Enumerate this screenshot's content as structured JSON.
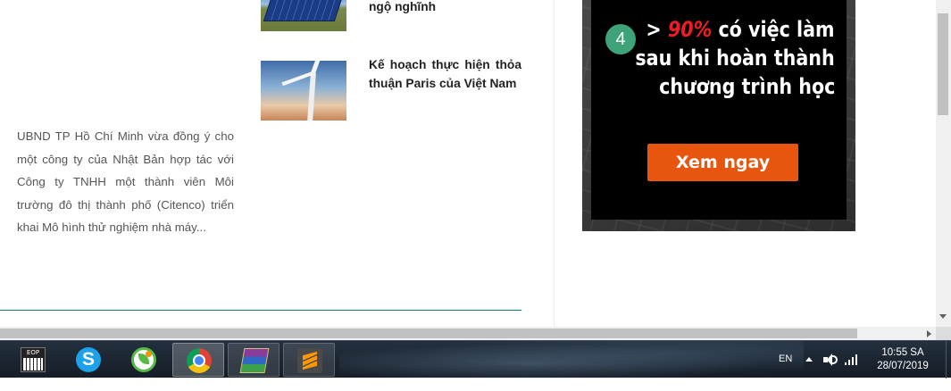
{
  "article": {
    "excerpt": "UBND TP Hồ Chí Minh vừa đồng ý cho một công ty của Nhật Bản hợp tác với Công ty TNHH một thành viên Môi trường đô thị thành phố (Citenco) triển khai Mô hình thử nghiệm nhà máy..."
  },
  "related": [
    {
      "title": "ngộ nghĩnh",
      "thumb": "solar-panel-image"
    },
    {
      "title": "Kế hoạch thực hiện thỏa thuận Paris của Việt Nam",
      "thumb": "wind-turbine-image"
    }
  ],
  "ad": {
    "step_number": "4",
    "line1_prefix": "> ",
    "line1_highlight": "90%",
    "line1_suffix": " có việc làm",
    "line2": "sau khi hoàn thành",
    "line3": "chương trình học",
    "cta_label": "Xem ngay",
    "colors": {
      "accent_red": "#ee1c24",
      "cta_orange": "#e8550e",
      "circle_green": "#3fa37a"
    }
  },
  "taskbar": {
    "apps": [
      {
        "name": "EOP",
        "icon": "piano-keyboard-icon",
        "label": "EOP"
      },
      {
        "name": "Skype",
        "icon": "skype-icon",
        "label": "S"
      },
      {
        "name": "Cốc Cốc",
        "icon": "coccoc-icon"
      },
      {
        "name": "Google Chrome",
        "icon": "chrome-icon",
        "active": true
      },
      {
        "name": "WinRAR",
        "icon": "winrar-icon",
        "open": true
      },
      {
        "name": "Sublime Text",
        "icon": "sublime-text-icon",
        "open": true
      }
    ],
    "language": "EN",
    "time": "10:55 SA",
    "date": "28/07/2019"
  }
}
